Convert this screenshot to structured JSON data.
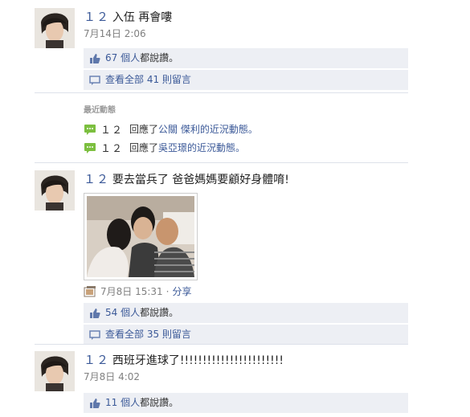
{
  "stories": [
    {
      "actor": "１２",
      "message": "入伍 再會嘍",
      "time": "7月14日 2:06",
      "likes_count": "67 個人",
      "likes_suffix": "都說讚。",
      "comments_label": "查看全部 41 則留言"
    },
    {
      "actor": "１２",
      "message": "要去當兵了 爸爸媽媽要顧好身體唷!",
      "time": "7月8日 15:31",
      "share_separator": "·",
      "share_label": "分享",
      "likes_count": "54 個人",
      "likes_suffix": "都說讚。",
      "comments_label": "查看全部 35 則留言"
    },
    {
      "actor": "１２",
      "message": "西班牙進球了!!!!!!!!!!!!!!!!!!!!!!!",
      "time": "7月8日 4:02",
      "likes_count": "11 個人",
      "likes_suffix": "都說讚。"
    }
  ],
  "recent_activity": {
    "title": "最近動態",
    "items": [
      {
        "actor": "１２",
        "verb": "回應了",
        "target": "公關 傑利",
        "suffix": "的近況動態。"
      },
      {
        "actor": "１２",
        "verb": "回應了",
        "target": "吳亞璟",
        "suffix": "的近況動態。"
      }
    ]
  },
  "colors": {
    "link": "#3b5998",
    "ufi_bg": "#edeff4",
    "meta": "#808080",
    "bubble": "#7cbf3f"
  }
}
